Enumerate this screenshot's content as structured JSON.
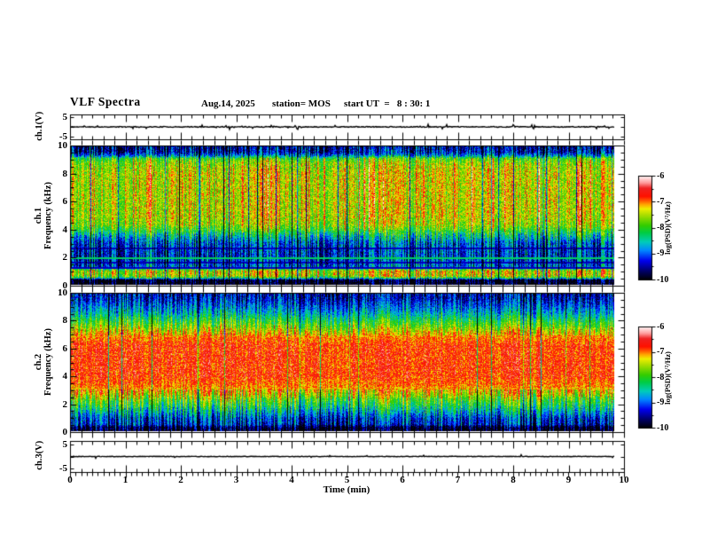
{
  "header": {
    "title": "VLF Spectra",
    "date": "Aug.14, 2025",
    "station": "station= MOS",
    "start_ut": "start UT  =   8 : 30: 1"
  },
  "xaxis": {
    "label": "Time (min)",
    "min": 0,
    "max": 10,
    "tick_labels": [
      "0",
      "1",
      "2",
      "3",
      "4",
      "5",
      "6",
      "7",
      "8",
      "9",
      "10"
    ],
    "minor_step": 0.1
  },
  "colorbar": {
    "label": "log(PSD)(V²/Hz)",
    "tick_labels": [
      "-6",
      "-7",
      "-8",
      "-9",
      "-10"
    ],
    "tick_values": [
      -6,
      -7,
      -8,
      -9,
      -10
    ],
    "range": [
      -10,
      -6
    ],
    "colormap": [
      [
        0.0,
        "#000006"
      ],
      [
        0.08,
        "#000066"
      ],
      [
        0.18,
        "#0000ee"
      ],
      [
        0.28,
        "#0088ff"
      ],
      [
        0.36,
        "#00ccbb"
      ],
      [
        0.45,
        "#00cc44"
      ],
      [
        0.52,
        "#33cc00"
      ],
      [
        0.62,
        "#aadd00"
      ],
      [
        0.68,
        "#eeee00"
      ],
      [
        0.72,
        "#ffaa00"
      ],
      [
        0.76,
        "#ff5500"
      ],
      [
        0.8,
        "#ff1100"
      ],
      [
        0.88,
        "#ee2222"
      ],
      [
        0.93,
        "#ff9999"
      ],
      [
        1.0,
        "#ffffff"
      ]
    ]
  },
  "chart_data": [
    {
      "id": "ch1_waveform",
      "type": "line",
      "ylabel": "ch.1(V)",
      "ytick_labels": [
        "5",
        "-5"
      ],
      "ytick_values": [
        5,
        0,
        -5
      ],
      "label_values": [
        5,
        -5
      ],
      "ylim": [
        -6.5,
        6.5
      ],
      "xlim": [
        0,
        10
      ],
      "data_end_min": 9.83,
      "baseline_v": 0,
      "jitter_v": 0.22,
      "blip_prob": 0.07,
      "blip_amp_v": 1.2,
      "seed": 11,
      "description": "near-flat 0 V trace with small impulsive blips"
    },
    {
      "id": "ch1_spectrogram",
      "type": "heatmap",
      "ylabel_line1": "ch.1",
      "ylabel_line2": "Frequency (kHz)",
      "ylim": [
        0,
        10
      ],
      "ytick_values": [
        10,
        8,
        6,
        4,
        2,
        0
      ],
      "ytick_labels": [
        "10",
        "8",
        "6",
        "4",
        "2",
        "0"
      ],
      "y_minor_step": 0.5,
      "xlim": [
        0,
        10
      ],
      "value_range": [
        -10,
        -6
      ],
      "profile": [
        [
          0,
          -10
        ],
        [
          0.32,
          -10
        ],
        [
          0.45,
          -8.3
        ],
        [
          0.6,
          -7.5
        ],
        [
          0.95,
          -7.35
        ],
        [
          1.1,
          -8.0
        ],
        [
          1.3,
          -9.0
        ],
        [
          2.2,
          -9.2
        ],
        [
          3.0,
          -9.0
        ],
        [
          3.4,
          -8.55
        ],
        [
          3.8,
          -8.1
        ],
        [
          4.3,
          -7.6
        ],
        [
          5.0,
          -7.45
        ],
        [
          8.0,
          -7.4
        ],
        [
          8.8,
          -7.6
        ],
        [
          9.15,
          -7.9
        ],
        [
          9.4,
          -8.9
        ],
        [
          9.6,
          -9.35
        ],
        [
          10,
          -9.45
        ]
      ],
      "dark_lines": [
        1.18,
        1.6,
        2.6
      ],
      "light_lines": [
        1.9
      ],
      "streak_amp": 0.5,
      "mid_range": [
        3.8,
        9.2
      ],
      "streak_scale": {
        "low": 1.5,
        "mid": 1.0,
        "high": 1.4
      },
      "noise": 0.45,
      "dark_col_prob": 0.05,
      "dark_col_depth": 1.8,
      "red_col_prob": 0.06,
      "red_col_boost": 0.8,
      "seed": 7,
      "description": "yellow-green 4-9 kHz band with red vertical streaks, blue 1.3-3.4 kHz band, bright 0.5-1 kHz band, black below 0.3 kHz"
    },
    {
      "id": "ch2_spectrogram",
      "type": "heatmap",
      "ylabel_line1": "ch.2",
      "ylabel_line2": "Frequency (kHz)",
      "ylim": [
        0,
        10
      ],
      "ytick_values": [
        10,
        8,
        6,
        4,
        2,
        0
      ],
      "ytick_labels": [
        "10",
        "8",
        "6",
        "4",
        "2",
        "0"
      ],
      "y_minor_step": 0.5,
      "xlim": [
        0,
        10
      ],
      "value_range": [
        -10,
        -6
      ],
      "profile": [
        [
          0,
          -10
        ],
        [
          0.25,
          -9.9
        ],
        [
          0.45,
          -9.3
        ],
        [
          0.9,
          -9.15
        ],
        [
          1.3,
          -8.7
        ],
        [
          1.8,
          -8.2
        ],
        [
          2.3,
          -7.8
        ],
        [
          2.8,
          -7.3
        ],
        [
          3.3,
          -7.0
        ],
        [
          4.0,
          -6.8
        ],
        [
          6.3,
          -6.8
        ],
        [
          6.9,
          -7.05
        ],
        [
          7.4,
          -7.5
        ],
        [
          8.0,
          -8.05
        ],
        [
          8.6,
          -8.6
        ],
        [
          9.2,
          -9.05
        ],
        [
          9.6,
          -9.3
        ],
        [
          10,
          -9.4
        ]
      ],
      "dark_lines": [],
      "light_lines": [],
      "streak_amp": 0.45,
      "mid_range": [
        3.0,
        7.0
      ],
      "streak_scale": {
        "low": 1.6,
        "mid": 0.55,
        "high": 1.3
      },
      "noise": 0.4,
      "dark_col_prob": 0.03,
      "dark_col_depth": 1.5,
      "red_col_prob": 0.0,
      "red_col_boost": 0,
      "seed": 13,
      "description": "solid red core 3-6.5 kHz fading to green/blue above 8 kHz, blue band 0.3-1.2 kHz, black at bottom"
    },
    {
      "id": "ch3_waveform",
      "type": "line",
      "ylabel": "ch.3(V)",
      "ytick_labels": [
        "5",
        "-5"
      ],
      "ytick_values": [
        5,
        0,
        -5
      ],
      "label_values": [
        5,
        -5
      ],
      "ylim": [
        -6.5,
        6.5
      ],
      "xlim": [
        0,
        10
      ],
      "data_end_min": 9.83,
      "baseline_v": 0,
      "jitter_v": 0.12,
      "blip_prob": 0.03,
      "blip_amp_v": 0.8,
      "seed": 21,
      "description": "near-flat 0 V trace, very few blips"
    }
  ]
}
